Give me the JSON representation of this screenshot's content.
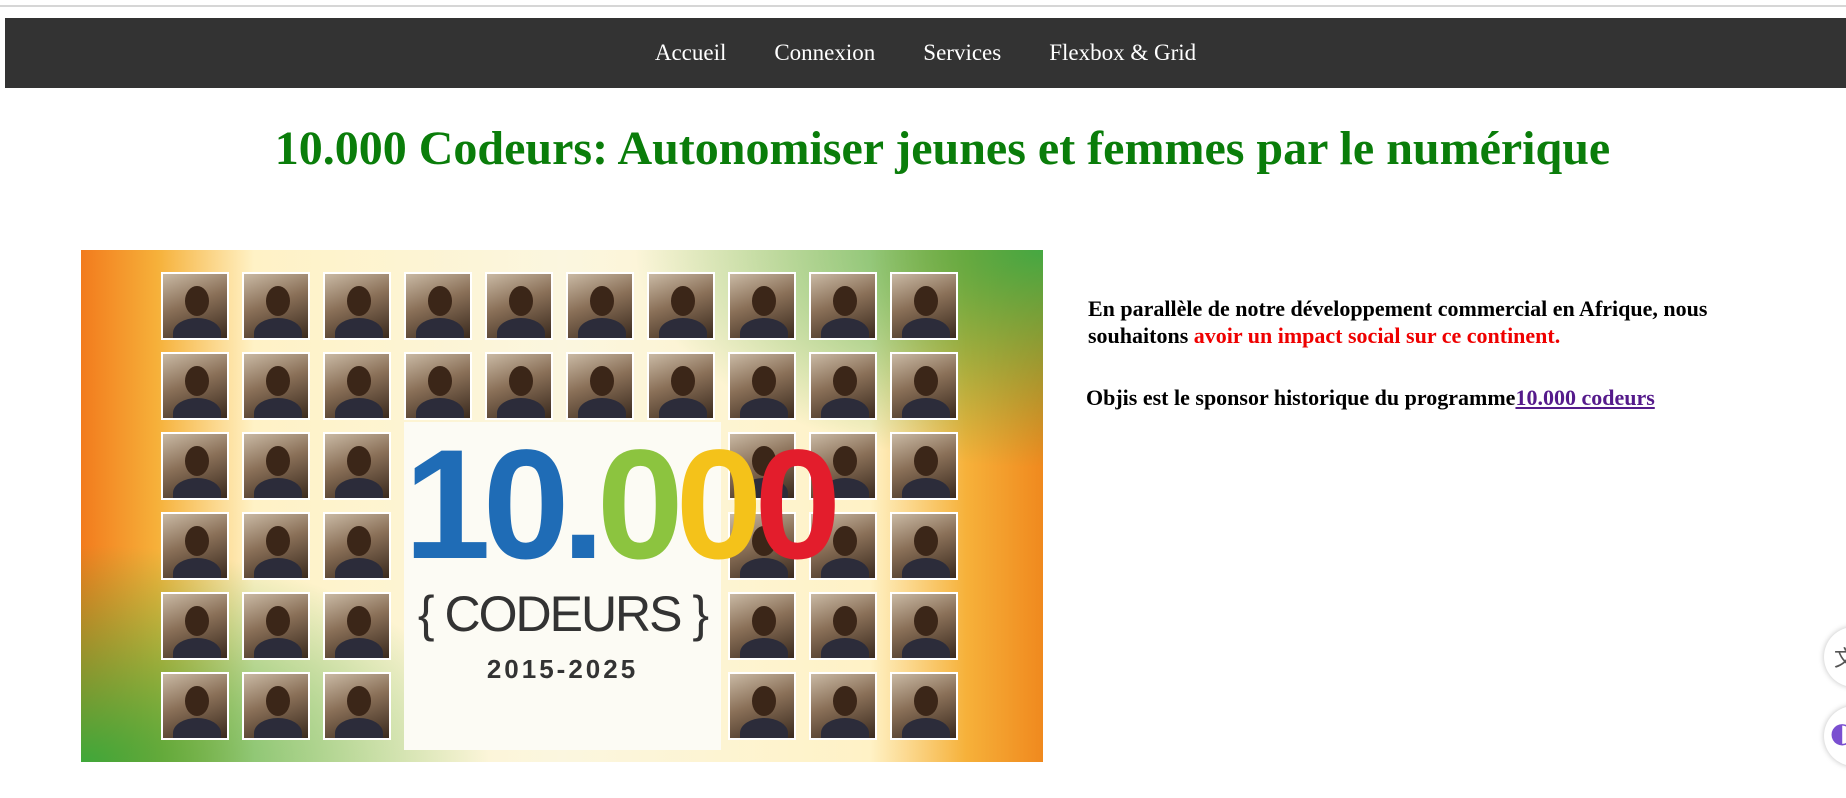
{
  "nav": {
    "items": [
      {
        "label": "Accueil"
      },
      {
        "label": "Connexion"
      },
      {
        "label": "Services"
      },
      {
        "label": "Flexbox & Grid"
      }
    ]
  },
  "main": {
    "title": "10.000 Codeurs: Autonomiser jeunes et femmes par le numérique",
    "banner": {
      "number_parts": [
        "10",
        ".",
        "0",
        "0",
        "0"
      ],
      "word": "{ CODEURS }",
      "years": "2015-2025"
    },
    "intro": {
      "text_before": "En parallèle de notre développement commercial en Afrique, nous souhaitons ",
      "highlight": "avoir un impact social sur ce continent."
    },
    "sponsor": {
      "text": "Objis est le sponsor historique du programme",
      "link_label": "10.000 codeurs"
    }
  },
  "floating_buttons": [
    {
      "icon": "translate-icon",
      "glyph": "文"
    },
    {
      "icon": "chat-icon",
      "glyph": "◐"
    }
  ],
  "colors": {
    "navbar_bg": "#333333",
    "title": "#0a7d0a",
    "highlight": "#ee0000",
    "link": "#551a8b",
    "logo_blue": "#1f6cb6",
    "logo_green": "#8cc43f",
    "logo_yellow": "#f4c21a",
    "logo_red": "#e31d2c"
  }
}
